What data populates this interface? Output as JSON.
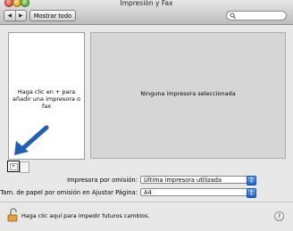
{
  "window": {
    "title": "Impresión y Fax"
  },
  "toolbar": {
    "back_label": "◀",
    "forward_label": "▶",
    "show_all_label": "Mostrar todo",
    "search_placeholder": ""
  },
  "printer_list": {
    "hint": "Haga clic en + para añadir una impresora o fax",
    "add_label": "+",
    "remove_label": ""
  },
  "detail": {
    "empty_message": "Ninguna impresora seleccionada"
  },
  "settings": {
    "default_printer_label": "Impresora por omisión:",
    "default_printer_value": "Última impresora utilizada",
    "default_paper_label": "Tam. de papel por omisión en Ajustar Página:",
    "default_paper_value": "A4"
  },
  "footer": {
    "lock_text": "Haga clic aquí para impedir futuros cambios.",
    "help_label": "?"
  },
  "colors": {
    "arrow": "#1f5fb5",
    "popup_accent": "#1f5fc9"
  }
}
